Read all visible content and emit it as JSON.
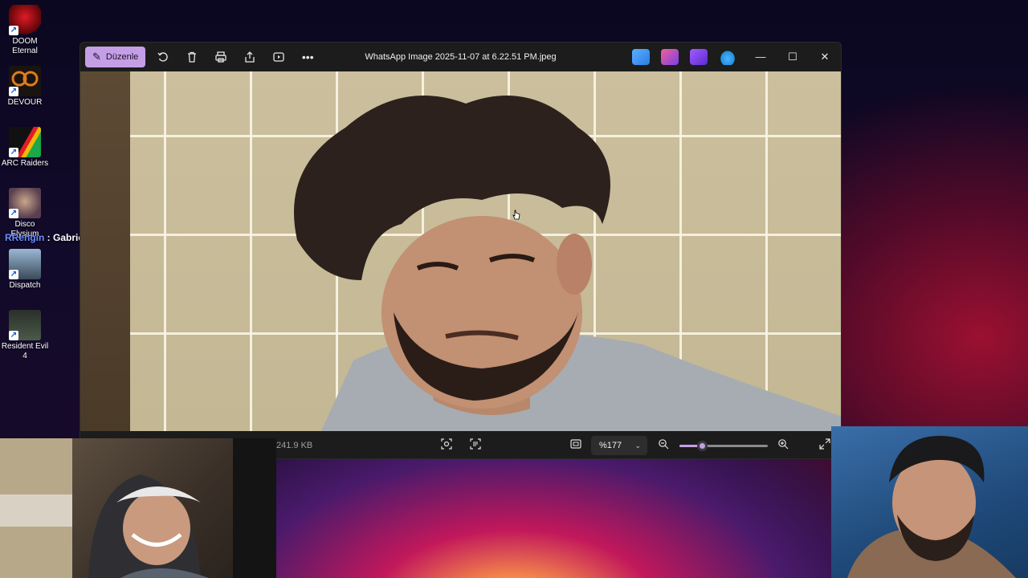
{
  "desktop": {
    "icons": [
      {
        "label": "DOOM Eternal",
        "icon": "doom-eternal-icon",
        "color": "#c1121f"
      },
      {
        "label": "DEVOUR",
        "icon": "devour-icon",
        "color": "#e07b1a"
      },
      {
        "label": "ARC Raiders",
        "icon": "arc-raiders-icon",
        "color": "#e8e8e8"
      },
      {
        "label": "Disco Elysium",
        "icon": "disco-elysium-icon",
        "color": "#8a6a8a"
      },
      {
        "label": "Dispatch",
        "icon": "dispatch-icon",
        "color": "#7a9ab8"
      },
      {
        "label": "Resident Evil 4",
        "icon": "resident-evil-icon",
        "color": "#4a5a4a"
      }
    ]
  },
  "chat": {
    "user": "RRengin",
    "separator": " : ",
    "message": "Gabriel sara"
  },
  "photos": {
    "edit_label": "Düzenle",
    "title": "WhatsApp Image 2025-11-07 at 6.22.51 PM.jpeg",
    "toolbar_icons": [
      "rotate-icon",
      "delete-icon",
      "print-icon",
      "share-icon",
      "slideshow-icon",
      "more-icon"
    ],
    "app_icons": [
      {
        "icon": "clipchamp-icon",
        "color": "#2a7de1"
      },
      {
        "icon": "designer-icon",
        "color": "#c13584"
      },
      {
        "icon": "video-editor-icon",
        "color": "#7b3fe4"
      },
      {
        "icon": "onedrive-icon",
        "color": "#2c9de6"
      }
    ],
    "file_size": "241.9 KB",
    "zoom": "%177",
    "zoom_fraction": 0.25,
    "accent": "#c59fe6"
  }
}
